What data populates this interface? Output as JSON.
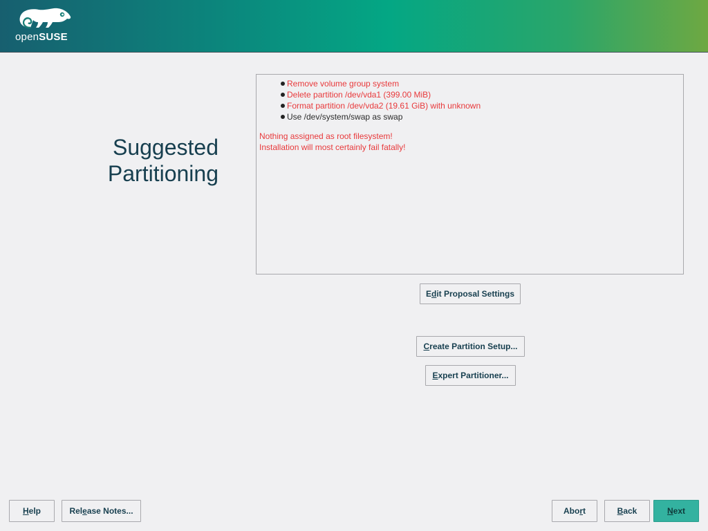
{
  "header": {
    "logo_open": "open",
    "logo_suse": "SUSE"
  },
  "page_title_line1": "Suggested",
  "page_title_line2": "Partitioning",
  "summary": {
    "actions": [
      {
        "text": "Remove volume group system",
        "color": "#e8393b"
      },
      {
        "text": "Delete partition /dev/vda1 (399.00 MiB)",
        "color": "#e8393b"
      },
      {
        "text": "Format partition /dev/vda2 (19.61 GiB) with unknown",
        "color": "#e8393b"
      },
      {
        "text": "Use /dev/system/swap as swap",
        "color": "#2b2b2b"
      }
    ],
    "warnings": [
      "Nothing assigned as root filesystem!",
      "Installation will most certainly fail fatally!"
    ]
  },
  "buttons": {
    "edit_proposal": {
      "pre": "E",
      "ul": "d",
      "post": "it Proposal Settings"
    },
    "create_partition": {
      "pre": "",
      "ul": "C",
      "post": "reate Partition Setup..."
    },
    "expert_partitioner": {
      "pre": "",
      "ul": "E",
      "post": "xpert Partitioner..."
    },
    "help": {
      "pre": "",
      "ul": "H",
      "post": "elp"
    },
    "release_notes": {
      "pre": "Rel",
      "ul": "e",
      "post": "ase Notes..."
    },
    "abort": {
      "pre": "Abo",
      "ul": "r",
      "post": "t"
    },
    "back": {
      "pre": "",
      "ul": "B",
      "post": "ack"
    },
    "next": {
      "pre": "",
      "ul": "N",
      "post": "ext"
    }
  },
  "colors": {
    "accent": "#33b2a0",
    "title": "#173f4f",
    "error": "#e8393b"
  }
}
